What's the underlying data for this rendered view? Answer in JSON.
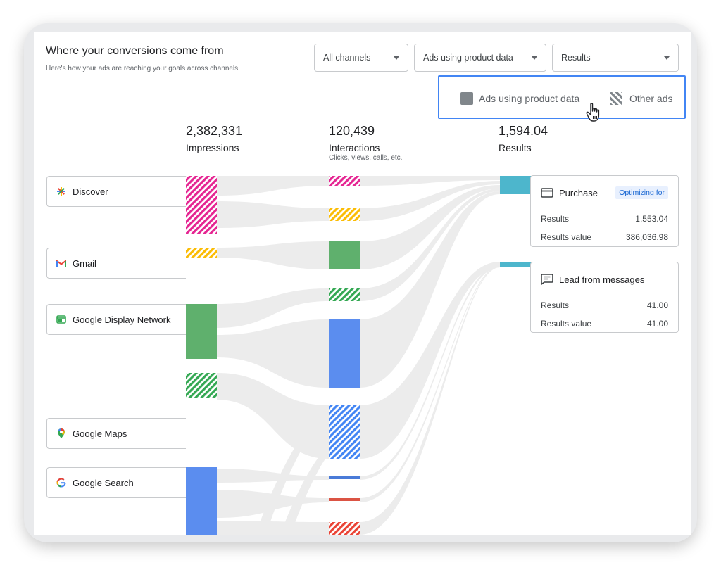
{
  "header": {
    "title": "Where your conversions come from",
    "subtitle": "Here's how your ads are reaching your goals across channels"
  },
  "filters": {
    "channels": "All channels",
    "ad_type": "Ads using product data",
    "metric": "Results"
  },
  "legend": {
    "solid_label": "Ads using product data",
    "hatched_label": "Other ads"
  },
  "stats": {
    "impressions": {
      "value": "2,382,331",
      "label": "Impressions"
    },
    "interactions": {
      "value": "120,439",
      "label": "Interactions",
      "sublabel": "Clicks, views, calls, etc."
    },
    "results": {
      "value": "1,594.04",
      "label": "Results"
    }
  },
  "channels": [
    {
      "name": "Discover",
      "icon": "discover-icon",
      "color": "#e52592"
    },
    {
      "name": "Gmail",
      "icon": "gmail-icon",
      "color": "#fbbc04"
    },
    {
      "name": "Google Display Network",
      "icon": "display-network-icon",
      "color": "#34a853"
    },
    {
      "name": "Google Maps",
      "icon": "maps-pin-icon",
      "color": "#34a853"
    },
    {
      "name": "Google Search",
      "icon": "google-g-icon",
      "color": "#4285f4"
    }
  ],
  "results_cards": [
    {
      "title": "Purchase",
      "icon": "credit-card-icon",
      "badge": "Optimizing for",
      "results_label": "Results",
      "results": "1,553.04",
      "value_label": "Results value",
      "value": "386,036.98"
    },
    {
      "title": "Lead from messages",
      "icon": "message-icon",
      "badge": "",
      "results_label": "Results",
      "results": "41.00",
      "value_label": "Results value",
      "value": "41.00"
    }
  ],
  "colors": {
    "discover": "#e52592",
    "gmail": "#fbbc04",
    "display": "#34a853",
    "search": "#4285f4",
    "results": "#4db6cc",
    "red": "#ea4335",
    "accent": "#4285f4"
  }
}
